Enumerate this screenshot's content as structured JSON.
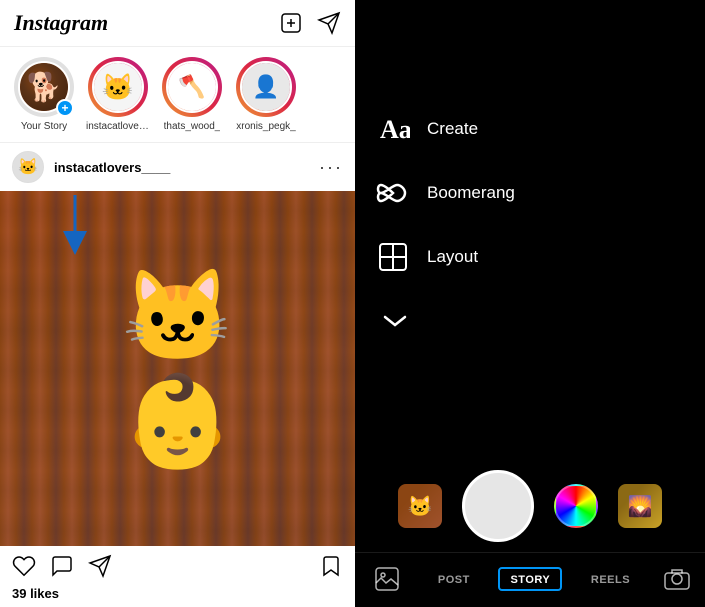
{
  "app": {
    "name": "Instagram"
  },
  "header": {
    "logo": "Instagram",
    "new_post_icon": "plus-square-icon",
    "send_icon": "send-icon"
  },
  "stories": [
    {
      "id": "your_story",
      "label": "Your Story",
      "has_ring": false,
      "add_button": true,
      "type": "dog"
    },
    {
      "id": "instacatlovers",
      "label": "instacatlovers___",
      "has_ring": true,
      "add_button": false,
      "type": "cat"
    },
    {
      "id": "thats_wood",
      "label": "thats_wood_",
      "has_ring": true,
      "add_button": false,
      "type": "wood"
    },
    {
      "id": "xronis_pegk",
      "label": "xronis_pegk_",
      "has_ring": true,
      "add_button": false,
      "type": "person"
    }
  ],
  "post": {
    "username": "instacatlovers____",
    "likes": "39 likes"
  },
  "camera": {
    "menu_items": [
      {
        "id": "create",
        "label": "Create",
        "icon": "text-icon"
      },
      {
        "id": "boomerang",
        "label": "Boomerang",
        "icon": "infinity-icon"
      },
      {
        "id": "layout",
        "label": "Layout",
        "icon": "layout-icon"
      }
    ],
    "chevron_label": "more options"
  },
  "bottom_tabs": [
    {
      "id": "post",
      "label": "POST",
      "active": false
    },
    {
      "id": "story",
      "label": "STORY",
      "active": true
    },
    {
      "id": "reels",
      "label": "REELS",
      "active": false
    }
  ]
}
